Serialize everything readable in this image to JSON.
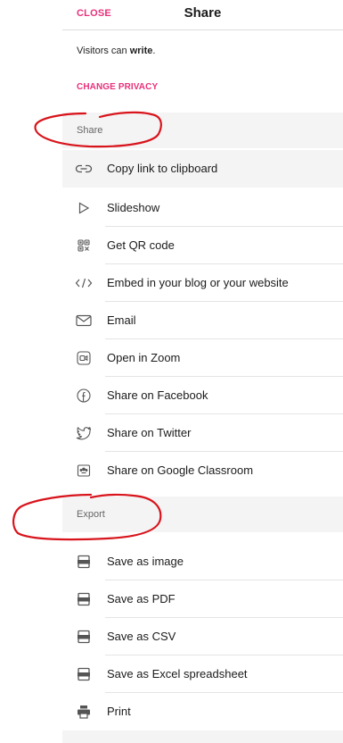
{
  "header": {
    "close_label": "CLOSE",
    "title": "Share"
  },
  "privacy": {
    "visitors_prefix": "Visitors can ",
    "visitors_permission": "write",
    "visitors_suffix": ".",
    "change_label": "CHANGE PRIVACY"
  },
  "share_section": {
    "heading": "Share",
    "items": [
      {
        "label": "Copy link to clipboard",
        "icon": "link-icon"
      },
      {
        "label": "Slideshow",
        "icon": "play-icon"
      },
      {
        "label": "Get QR code",
        "icon": "qr-code-icon"
      },
      {
        "label": "Embed in your blog or your website",
        "icon": "code-icon"
      },
      {
        "label": "Email",
        "icon": "envelope-icon"
      },
      {
        "label": "Open in Zoom",
        "icon": "zoom-icon"
      },
      {
        "label": "Share on Facebook",
        "icon": "facebook-icon"
      },
      {
        "label": "Share on Twitter",
        "icon": "twitter-icon"
      },
      {
        "label": "Share on Google Classroom",
        "icon": "google-classroom-icon"
      }
    ]
  },
  "export_section": {
    "heading": "Export",
    "items": [
      {
        "label": "Save as image",
        "icon": "png-file-icon"
      },
      {
        "label": "Save as PDF",
        "icon": "pdf-file-icon"
      },
      {
        "label": "Save as CSV",
        "icon": "csv-file-icon"
      },
      {
        "label": "Save as Excel spreadsheet",
        "icon": "xls-file-icon"
      },
      {
        "label": "Print",
        "icon": "printer-icon"
      }
    ]
  },
  "colors": {
    "accent": "#e8317b",
    "section_bg": "#f4f4f4",
    "annotation": "#d8141c"
  }
}
